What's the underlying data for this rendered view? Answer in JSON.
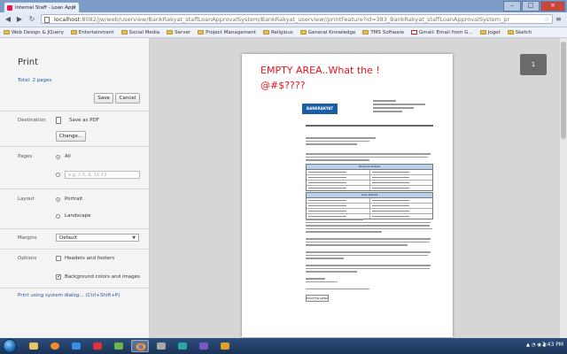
{
  "browser": {
    "tab_title": "Internal Staff - Loan Appl",
    "url_host": "localhost",
    "url_rest": ":8082/jw/web/userview/BankRakyat_staffLoanApprovalSystem/BankRakyat_userview//printFeature?id=383_BankRakyat_staffLoanApprovalSystem_pr",
    "bookmarks": [
      "Web Design & JQuery",
      "Entertainment",
      "Social Media",
      "Server",
      "Project Management",
      "Religious",
      "General Knowledge",
      "TMS Software",
      "Gmail: Email from G...",
      "Joget",
      "Sketch"
    ]
  },
  "print_panel": {
    "title": "Print",
    "total": "Total: 2 pages",
    "save_label": "Save",
    "cancel_label": "Cancel",
    "destination": {
      "label": "Destination",
      "value": "Save as PDF",
      "change_label": "Change..."
    },
    "pages": {
      "label": "Pages",
      "all_label": "All",
      "range_placeholder": "e.g. 1-5, 8, 11-13"
    },
    "layout": {
      "label": "Layout",
      "portrait": "Portrait",
      "landscape": "Landscape"
    },
    "margins": {
      "label": "Margins",
      "selected": "Default"
    },
    "options": {
      "label": "Options",
      "headers": "Headers and footers",
      "background": "Background colors and images"
    },
    "system_dialog": "Print using system dialog... (Ctrl+Shift+P)"
  },
  "preview": {
    "page_number": "1",
    "annotation_line1": "EMPTY AREA..What the !",
    "annotation_line2": "@#$????",
    "logo_text": "BANKRAKYAT",
    "table_header_1": "Personal Details",
    "table_header_2": "Loan Details",
    "print_button": "Print This Letter"
  },
  "taskbar": {
    "time": "2:43 PM"
  }
}
